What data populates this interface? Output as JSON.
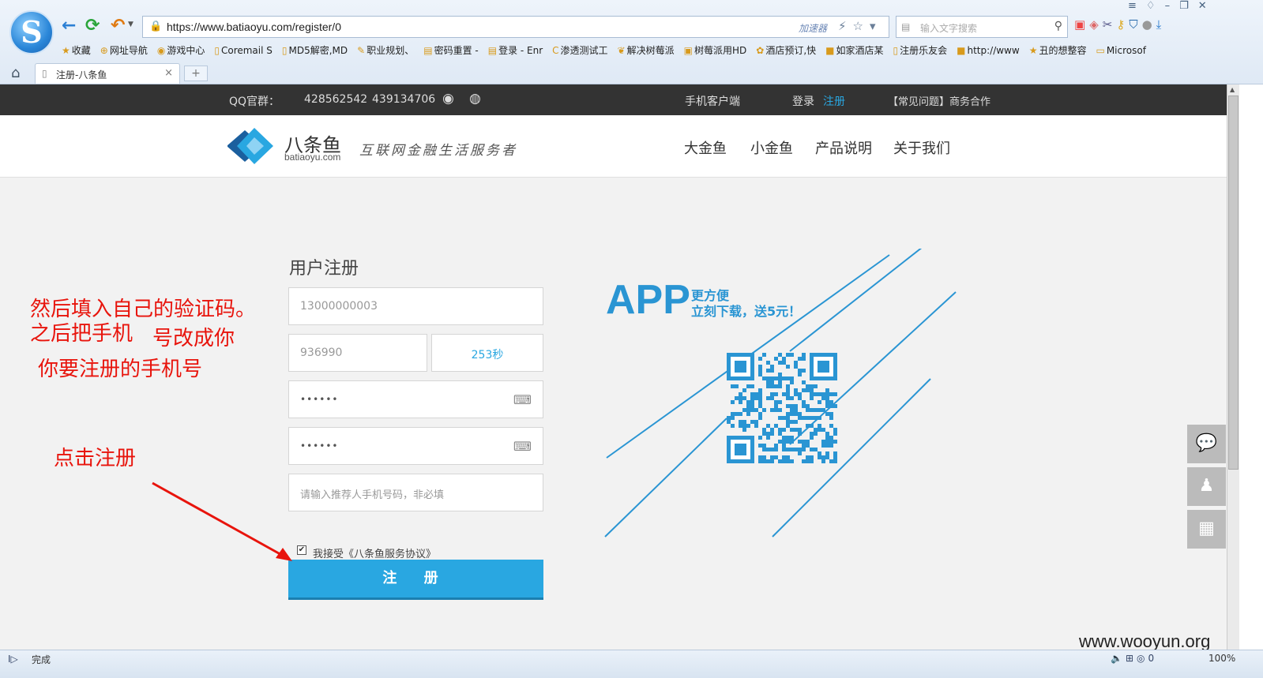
{
  "browser": {
    "url": "https://www.batiaoyu.com/register/0",
    "accelerator": "加速器",
    "search_placeholder": "输入文字搜索",
    "bookmarks": [
      "收藏",
      "网址导航",
      "游戏中心",
      "Coremail S",
      "MD5解密,MD",
      "职业规划、",
      "密码重置 -",
      "登录 - Enr",
      "渗透测试工",
      "解决树莓派",
      "树莓派用HD",
      "酒店预订,快",
      "如家酒店某",
      "注册乐友会",
      "http://www",
      "丑的想整容",
      "Microsof"
    ],
    "tab_title": "注册-八条鱼",
    "status_text": "完成",
    "status_count": "0",
    "zoom": "100%"
  },
  "topbar": {
    "qq_label": "QQ官群：",
    "qq_group1": "428562542",
    "qq_group2": "439134706",
    "mobile_client": "手机客户端",
    "login": "登录",
    "register": "注册",
    "faq": "【常见问题】商务合作"
  },
  "header": {
    "site_name": "八条鱼",
    "site_domain": "batiaoyu.com",
    "slogan": "互联网金融生活服务者",
    "nav": [
      "大金鱼",
      "小金鱼",
      "产品说明",
      "关于我们"
    ]
  },
  "form": {
    "title": "用户注册",
    "phone_value": "13000000003",
    "code_value": "936990",
    "timer": "253秒",
    "password_mask": "••••••",
    "confirm_mask": "••••••",
    "referrer_placeholder": "请输入推荐人手机号码，非必填",
    "agree_text": "我接受《八条鱼服务协议》",
    "submit": "注 册"
  },
  "promo": {
    "big": "APP",
    "line1": "更方便",
    "line2": "立刻下载，送5元！"
  },
  "annotations": {
    "a1": "然后填入自己的验证码。",
    "a2": "之后把手机",
    "a3": "号改成你",
    "a4": "你要注册的手机号",
    "a5": "点击注册"
  },
  "watermark": "www.wooyun.org",
  "colors": {
    "brand_blue": "#29a7e1",
    "annotation_red": "#e8140c",
    "topbar": "#333333"
  }
}
